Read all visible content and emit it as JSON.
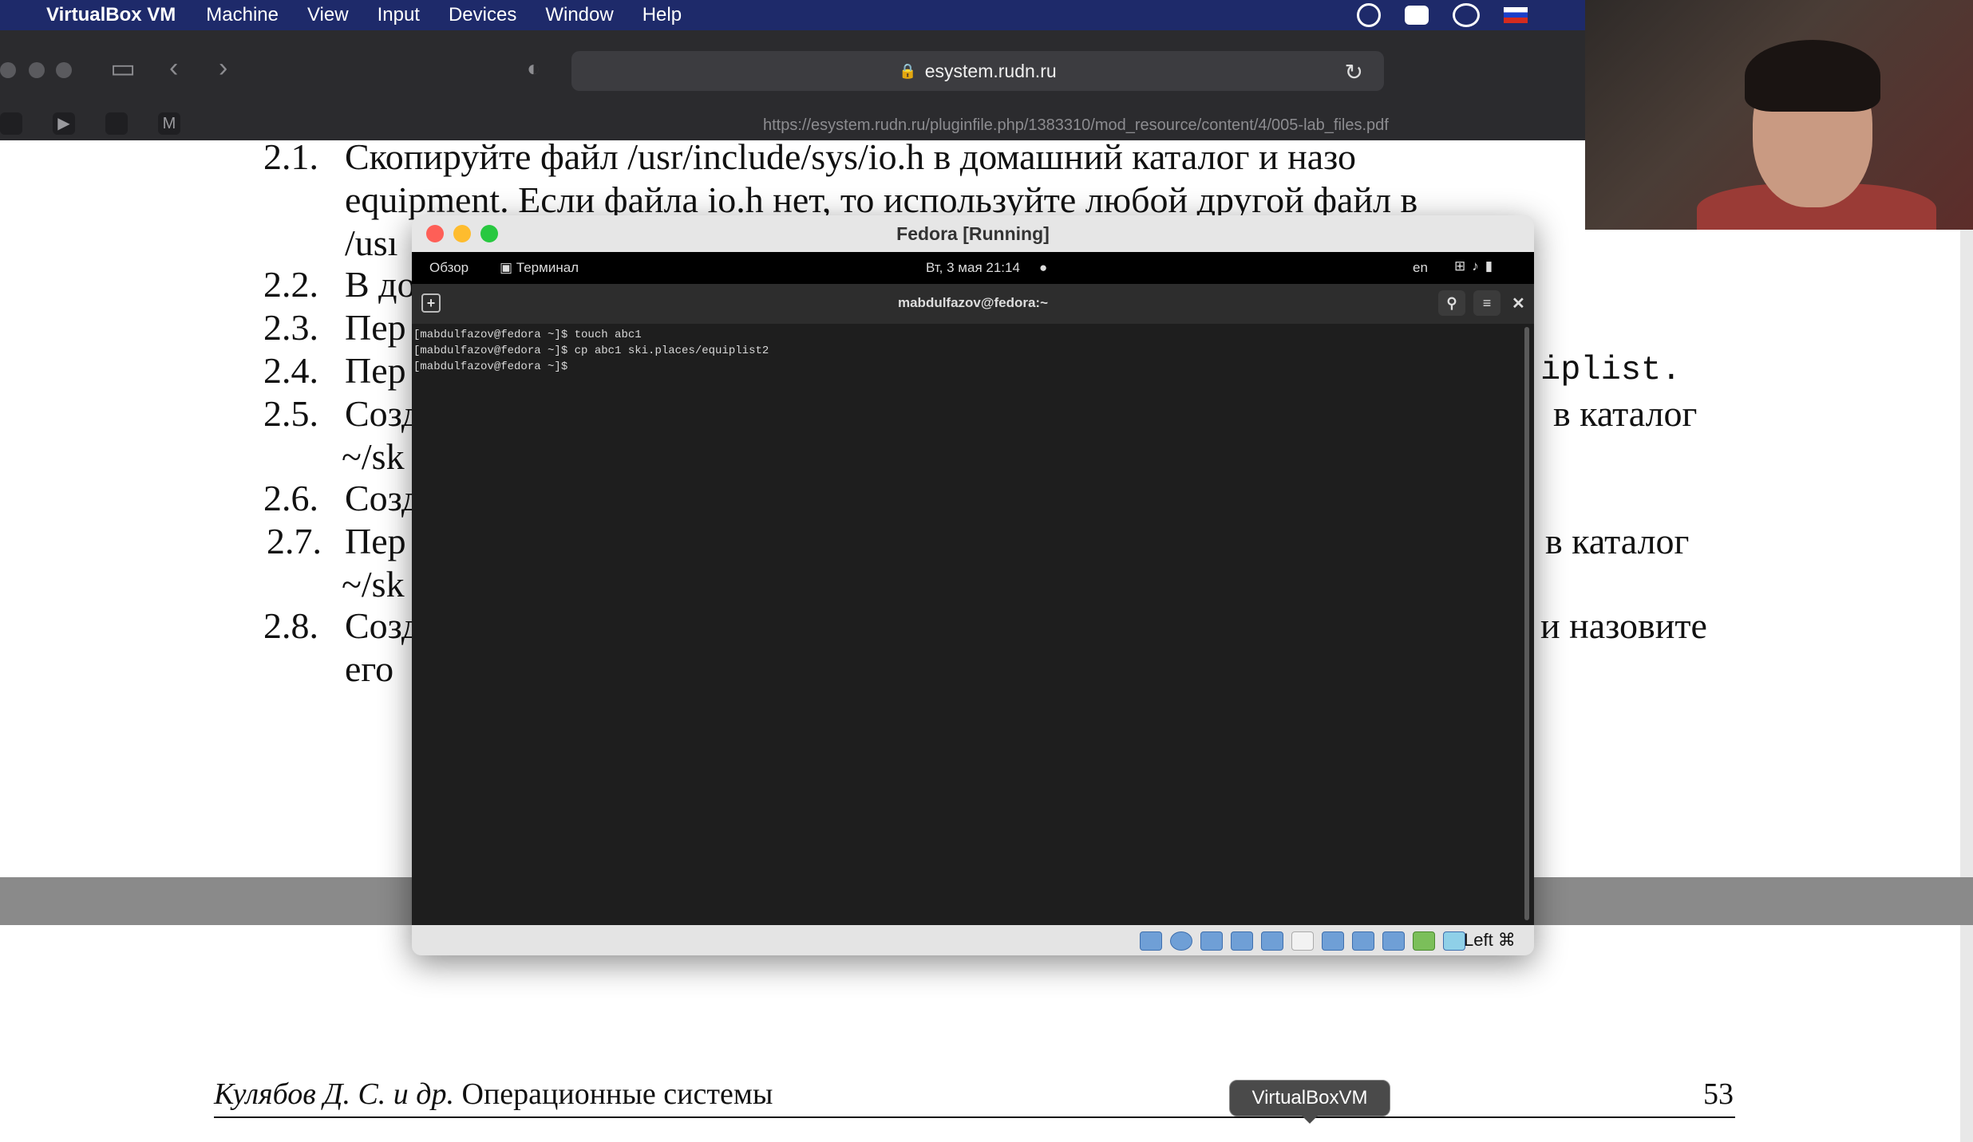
{
  "menubar": {
    "app_name": "VirtualBox VM",
    "items": [
      "Machine",
      "View",
      "Input",
      "Devices",
      "Window",
      "Help"
    ]
  },
  "browser": {
    "domain": "esystem.rudn.ru",
    "full_url": "https://esystem.rudn.ru/pluginfile.php/1383310/mod_resource/content/4/005-lab_files.pdf"
  },
  "pdf": {
    "lines": [
      {
        "num": "2.1.",
        "text": "Скопируйте файл /usr/include/sys/io.h в домашний каталог и назо"
      },
      {
        "num": "",
        "text": "equipment. Если файла io.h нет, то используйте любой другой файл в"
      },
      {
        "num": "",
        "text": "/usı"
      },
      {
        "num": "2.2.",
        "text": "В до"
      },
      {
        "num": "2.3.",
        "text": "Пер"
      },
      {
        "num": "2.4.",
        "text": "Пер",
        "tail": "iplist."
      },
      {
        "num": "2.5.",
        "text": "Созд",
        "tail": "в   каталог"
      },
      {
        "num": "",
        "text": "~/sk"
      },
      {
        "num": "2.6.",
        "text": "Созд"
      },
      {
        "num": "2.7.",
        "text": "Пер",
        "tail": "в   каталог"
      },
      {
        "num": "",
        "text": "~/sk"
      },
      {
        "num": "2.8.",
        "text": "Созд",
        "tail": "и назовите"
      },
      {
        "num": "",
        "text": "его"
      }
    ],
    "footer_author": "Кулябов Д. С. и др.",
    "footer_title": "Операционные системы",
    "page_number": "53"
  },
  "vbox": {
    "window_title": "Fedora [Running]",
    "gnome": {
      "overview": "Обзор",
      "terminal_app": "Терминал",
      "clock": "Вт, 3 мая  21:14",
      "dot": "●",
      "lang": "en"
    },
    "terminal": {
      "title": "mabdulfazov@fedora:~",
      "lines": [
        "[mabdulfazov@fedora ~]$ touch abc1",
        "[mabdulfazov@fedora ~]$ cp abc1 ski.places/equiplist2",
        "[mabdulfazov@fedora ~]$ "
      ]
    },
    "host_key": "Left ⌘"
  },
  "dock_tooltip": "VirtualBoxVM"
}
